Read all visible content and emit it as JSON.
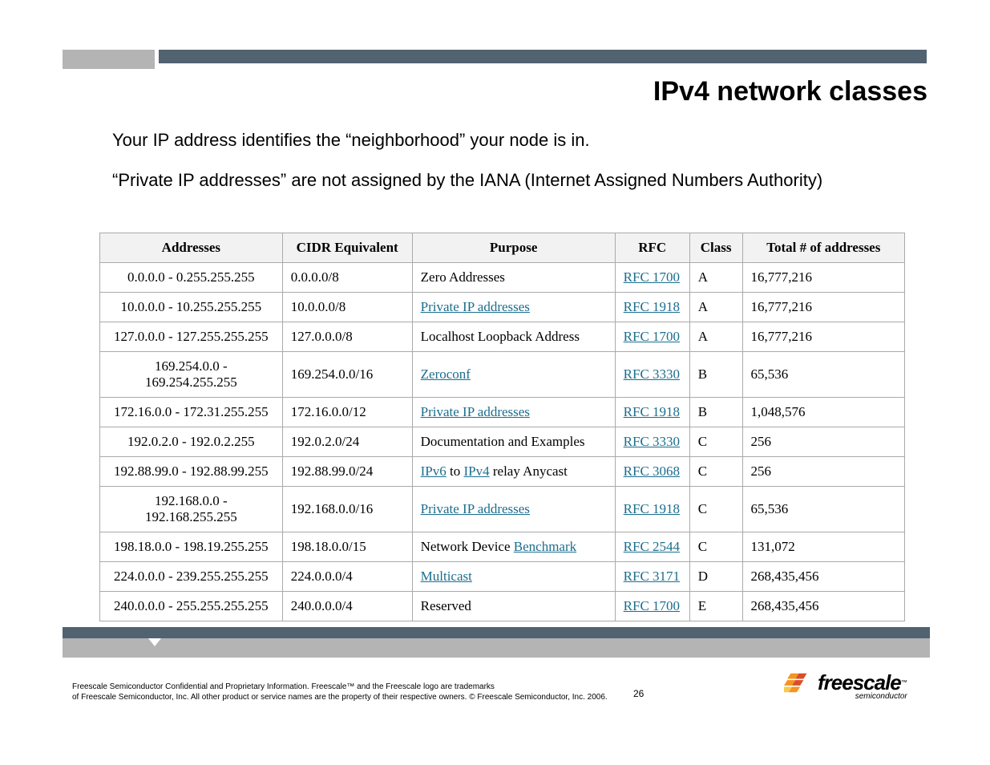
{
  "title": "IPv4 network classes",
  "para1": "Your IP address identifies the “neighborhood” your node is in.",
  "para2": "“Private IP addresses” are not assigned by the IANA (Internet Assigned Numbers Authority)",
  "headers": {
    "addresses": "Addresses",
    "cidr": "CIDR Equivalent",
    "purpose": "Purpose",
    "rfc": "RFC",
    "class": "Class",
    "total": "Total # of addresses"
  },
  "rows": [
    {
      "addr": "0.0.0.0 - 0.255.255.255",
      "cidr": "0.0.0.0/8",
      "purpose_plain": "Zero Addresses",
      "rfc": "RFC 1700",
      "class": "A",
      "total": "16,777,216"
    },
    {
      "addr": "10.0.0.0 - 10.255.255.255",
      "cidr": "10.0.0.0/8",
      "purpose_link": "Private IP addresses",
      "rfc": "RFC 1918",
      "class": "A",
      "total": "16,777,216"
    },
    {
      "addr": "127.0.0.0 - 127.255.255.255",
      "cidr": "127.0.0.0/8",
      "purpose_plain": "Localhost Loopback Address",
      "rfc": "RFC 1700",
      "class": "A",
      "total": "16,777,216"
    },
    {
      "addr": "169.254.0.0 - 169.254.255.255",
      "cidr": "169.254.0.0/16",
      "purpose_link": "Zeroconf",
      "rfc": "RFC 3330",
      "class": "B",
      "total": "65,536"
    },
    {
      "addr": "172.16.0.0 - 172.31.255.255",
      "cidr": "172.16.0.0/12",
      "purpose_link": "Private IP addresses",
      "rfc": "RFC 1918",
      "class": "B",
      "total": "1,048,576"
    },
    {
      "addr": "192.0.2.0 - 192.0.2.255",
      "cidr": "192.0.2.0/24",
      "purpose_plain": "Documentation and Examples",
      "rfc": "RFC 3330",
      "class": "C",
      "total": "256"
    },
    {
      "addr": "192.88.99.0 - 192.88.99.255",
      "cidr": "192.88.99.0/24",
      "purpose_html": "<a class='link' href='#'>IPv6</a> to <a class='link' href='#'>IPv4</a> relay Anycast",
      "rfc": "RFC 3068",
      "class": "C",
      "total": "256"
    },
    {
      "addr": "192.168.0.0 - 192.168.255.255",
      "cidr": "192.168.0.0/16",
      "purpose_link": "Private IP addresses",
      "rfc": "RFC 1918",
      "class": "C",
      "total": "65,536"
    },
    {
      "addr": "198.18.0.0 - 198.19.255.255",
      "cidr": "198.18.0.0/15",
      "purpose_html": "Network Device <a class='link' href='#'>Benchmark</a>",
      "rfc": "RFC 2544",
      "class": "C",
      "total": "131,072"
    },
    {
      "addr": "224.0.0.0 - 239.255.255.255",
      "cidr": "224.0.0.0/4",
      "purpose_link": "Multicast",
      "rfc": "RFC 3171",
      "class": "D",
      "total": "268,435,456"
    },
    {
      "addr": "240.0.0.0 - 255.255.255.255",
      "cidr": "240.0.0.0/4",
      "purpose_plain": "Reserved",
      "rfc": "RFC 1700",
      "class": "E",
      "total": "268,435,456"
    }
  ],
  "footer": {
    "line1": "Freescale Semiconductor Confidential and Proprietary Information. Freescale™ and the Freescale logo are trademarks",
    "line2": "of Freescale Semiconductor, Inc. All other product or service names are the property of their respective owners. © Freescale Semiconductor, Inc. 2006.",
    "page": "26",
    "logo_main": "freescale",
    "logo_tm": "™",
    "logo_sub": "semiconductor"
  }
}
